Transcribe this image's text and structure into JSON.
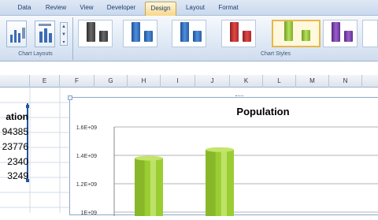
{
  "ribbon": {
    "tabs": [
      "Data",
      "Review",
      "View",
      "Developer",
      "Design",
      "Layout",
      "Format"
    ],
    "active_tab": "Design",
    "groups": {
      "chart_layouts": "Chart Layouts",
      "chart_styles": "Chart Styles"
    },
    "style_colors": [
      "#4a4a4a",
      "#2f6fbf",
      "#2f6fbf",
      "#c93030",
      "#8fc23a",
      "#7a3fa8",
      "#7a3fa8"
    ]
  },
  "sheet": {
    "columns": [
      "E",
      "F",
      "G",
      "H",
      "I",
      "J",
      "K",
      "L",
      "M",
      "N"
    ],
    "cells": [
      "ation",
      "94385",
      "23776",
      "2340",
      "3249"
    ]
  },
  "chart_data": {
    "type": "bar",
    "title": "Population",
    "categories": [
      "",
      ""
    ],
    "values": [
      1380000000,
      1440000000
    ],
    "ytick_labels": [
      "1.6E+09",
      "1.4E+09",
      "1.2E+09",
      "1E+09"
    ],
    "ylim": [
      1000000000,
      1600000000
    ],
    "colors": {
      "bar": "#9acd32"
    }
  }
}
